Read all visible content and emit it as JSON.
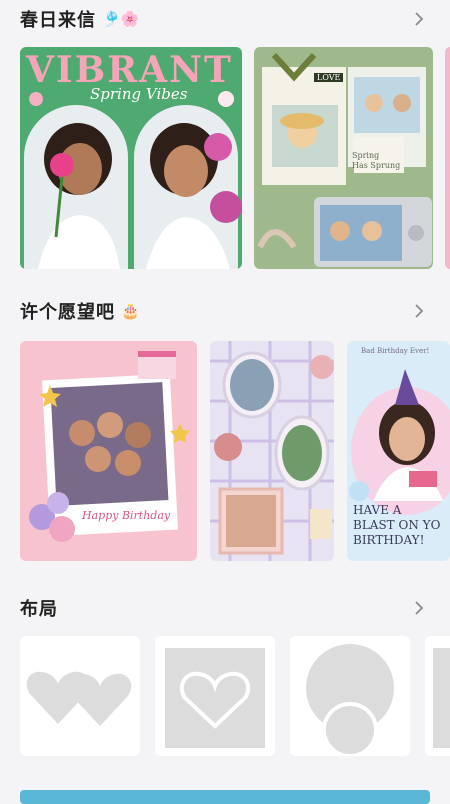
{
  "sections": [
    {
      "title": "春日来信",
      "emoji": "🎐🌸"
    },
    {
      "title": "许个愿望吧",
      "emoji": "🎂"
    },
    {
      "title": "布局",
      "emoji": ""
    }
  ],
  "spring_cards": {
    "card1": {
      "title": "VIBRANT",
      "subtitle": "Spring Vibes"
    },
    "card2": {
      "tag": "LOVE",
      "note": "Spring\nHas Sprung"
    }
  },
  "birthday_cards": {
    "card1": {
      "caption": "Happy Birthday"
    },
    "card3": {
      "top_text": "Bad Birthday Ever!",
      "headline": "HAVE A\nBLAST ON YO\nBIRTHDAY!"
    }
  },
  "colors": {
    "background": "#f4f4f6",
    "tile": "#ffffff",
    "shape": "#dcdcdc"
  }
}
